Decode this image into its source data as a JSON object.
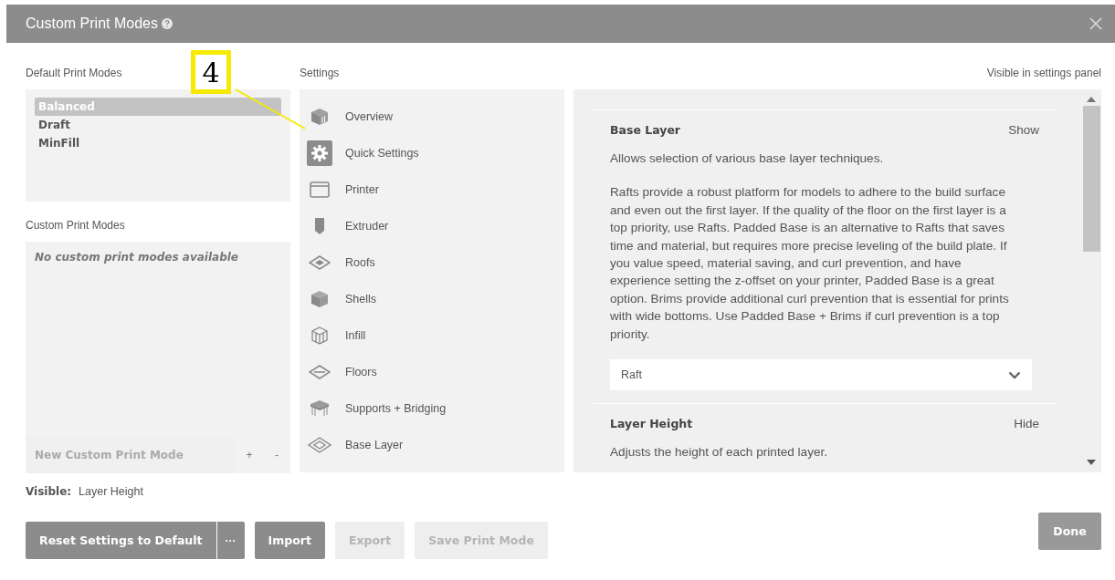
{
  "window": {
    "title": "Custom Print Modes"
  },
  "default_modes": {
    "heading": "Default Print Modes",
    "items": [
      {
        "label": "Balanced",
        "selected": true
      },
      {
        "label": "Draft",
        "selected": false
      },
      {
        "label": "MinFill",
        "selected": false
      }
    ]
  },
  "custom_modes": {
    "heading": "Custom Print Modes",
    "empty_text": "No custom print modes available",
    "new_placeholder": "New Custom Print Mode",
    "add": "+",
    "remove": "-"
  },
  "visible": {
    "label": "Visible:",
    "value": "Layer Height"
  },
  "settings": {
    "heading": "Settings",
    "items": [
      {
        "label": "Overview",
        "selected": false
      },
      {
        "label": "Quick Settings",
        "selected": true
      },
      {
        "label": "Printer",
        "selected": false
      },
      {
        "label": "Extruder",
        "selected": false
      },
      {
        "label": "Roofs",
        "selected": false
      },
      {
        "label": "Shells",
        "selected": false
      },
      {
        "label": "Infill",
        "selected": false
      },
      {
        "label": "Floors",
        "selected": false
      },
      {
        "label": "Supports + Bridging",
        "selected": false
      },
      {
        "label": "Base Layer",
        "selected": false
      }
    ]
  },
  "panel": {
    "heading": "Visible in settings panel",
    "sections": [
      {
        "title": "Base Layer",
        "toggle": "Show",
        "paragraphs": [
          "Allows selection of various base layer techniques.",
          "Rafts provide a robust platform for models to adhere to the build surface and even out the first layer. If the quality of the floor on the first layer is a top priority, use Rafts. Padded Base is an alternative to Rafts that saves time and material, but requires more precise leveling of the build plate. If you value speed, material saving, and curl prevention, and have experience setting the z-offset on your printer, Padded Base is a great option. Brims provide additional curl prevention that is essential for prints with wide bottoms. Use Padded Base + Brims if curl prevention is a top priority."
        ],
        "dropdown": "Raft"
      },
      {
        "title": "Layer Height",
        "toggle": "Hide",
        "paragraphs": [
          "Adjusts the height of each printed layer."
        ]
      }
    ]
  },
  "buttons": [
    {
      "label": "Reset Settings to Default",
      "disabled": false,
      "menu": "···"
    },
    {
      "label": "Import",
      "disabled": false
    },
    {
      "label": "Export",
      "disabled": true
    },
    {
      "label": "Save Print Mode",
      "disabled": true
    }
  ],
  "done": "Done",
  "callout": {
    "label": "4"
  }
}
